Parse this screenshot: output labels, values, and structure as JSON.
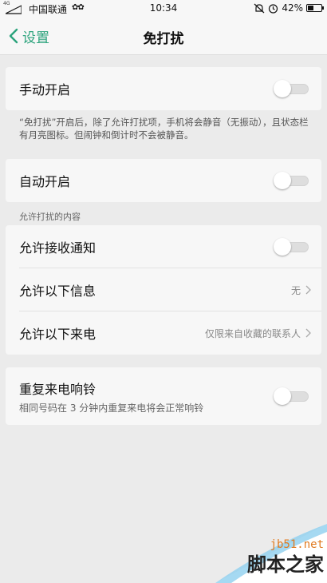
{
  "status_bar": {
    "network": "4G",
    "carrier": "中国联通",
    "carrier_icons": "✿✿",
    "time": "10:34",
    "battery_text": "42%",
    "battery_level": 0.42
  },
  "nav": {
    "back_label": "设置",
    "title": "免打扰"
  },
  "manual": {
    "label": "手动开启",
    "enabled": false,
    "note": "“免打扰”开启后，除了允许打扰项，手机将会静音（无振动），且状态栏有月亮图标。但闹钟和倒计时不会被静音。"
  },
  "auto": {
    "label": "自动开启",
    "enabled": false
  },
  "allowed": {
    "header": "允许打扰的内容",
    "items": [
      {
        "label": "允许接收通知",
        "type": "toggle",
        "enabled": false
      },
      {
        "label": "允许以下信息",
        "type": "select",
        "value": "无"
      },
      {
        "label": "允许以下来电",
        "type": "select",
        "value": "仅限来自收藏的联系人"
      }
    ]
  },
  "repeat": {
    "label": "重复来电响铃",
    "sub": "相同号码在 3 分钟内重复来电将会正常响铃",
    "enabled": false
  },
  "watermark": {
    "site": "jb51.net",
    "brand": "脚本之家"
  },
  "colors": {
    "accent": "#2ba37c",
    "watermark_site": "#e07a1f"
  }
}
